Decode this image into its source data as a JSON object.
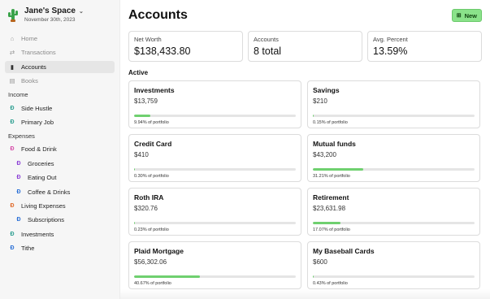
{
  "workspace": {
    "name": "Jane's Space",
    "date": "November 30th, 2023"
  },
  "nav": [
    {
      "label": "Home",
      "icon": "home-icon",
      "glyph": "⌂",
      "state": "dim"
    },
    {
      "label": "Transactions",
      "icon": "transactions-icon",
      "glyph": "⇄",
      "state": "dim"
    },
    {
      "label": "Accounts",
      "icon": "chart-icon",
      "glyph": "▮",
      "state": "active"
    },
    {
      "label": "Books",
      "icon": "book-icon",
      "glyph": "▤",
      "state": "dim"
    }
  ],
  "income": {
    "label": "Income",
    "items": [
      {
        "label": "Side Hustle",
        "color": "#2a9d8f"
      },
      {
        "label": "Primary Job",
        "color": "#2a9d8f"
      }
    ]
  },
  "expenses": {
    "label": "Expenses",
    "items": [
      {
        "label": "Food & Drink",
        "color": "#d64aa8",
        "sub": false
      },
      {
        "label": "Groceries",
        "color": "#8b3fd6",
        "sub": true
      },
      {
        "label": "Eating Out",
        "color": "#8b3fd6",
        "sub": true
      },
      {
        "label": "Coffee & Drinks",
        "color": "#2a6fd6",
        "sub": true
      },
      {
        "label": "Living Expenses",
        "color": "#e06a2a",
        "sub": false
      },
      {
        "label": "Subscriptions",
        "color": "#2a6fd6",
        "sub": true
      },
      {
        "label": "Investments",
        "color": "#2a9d8f",
        "sub": false
      },
      {
        "label": "Tithe",
        "color": "#2a6fd6",
        "sub": false
      }
    ]
  },
  "header": {
    "title": "Accounts",
    "new_label": "New"
  },
  "stats": [
    {
      "label": "Net Worth",
      "value": "$138,433.80"
    },
    {
      "label": "Accounts",
      "value": "8 total"
    },
    {
      "label": "Avg. Percent",
      "value": "13.59%"
    }
  ],
  "section": {
    "title": "Active"
  },
  "accounts": [
    {
      "name": "Investments",
      "balance": "$13,759",
      "percent_text": "9.94% of portfolio",
      "percent": 9.94
    },
    {
      "name": "Savings",
      "balance": "$210",
      "percent_text": "0.15% of portfolio",
      "percent": 0.15
    },
    {
      "name": "Credit Card",
      "balance": "$410",
      "percent_text": "0.30% of portfolio",
      "percent": 0.3
    },
    {
      "name": "Mutual funds",
      "balance": "$43,200",
      "percent_text": "31.21% of portfolio",
      "percent": 31.21
    },
    {
      "name": "Roth IRA",
      "balance": "$320.76",
      "percent_text": "0.23% of portfolio",
      "percent": 0.23
    },
    {
      "name": "Retirement",
      "balance": "$23,631.98",
      "percent_text": "17.07% of portfolio",
      "percent": 17.07
    },
    {
      "name": "Plaid Mortgage",
      "balance": "$56,302.06",
      "percent_text": "40.67% of portfolio",
      "percent": 40.67
    },
    {
      "name": "My Baseball Cards",
      "balance": "$600",
      "percent_text": "0.43% of portfolio",
      "percent": 0.43
    }
  ]
}
